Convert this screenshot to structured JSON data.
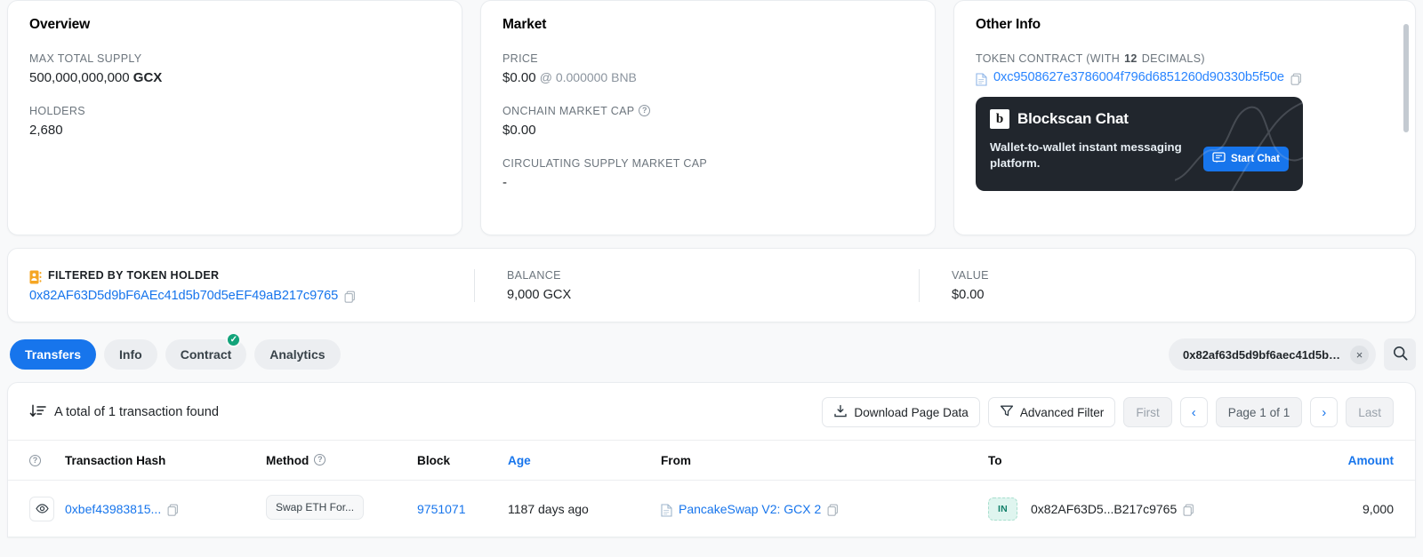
{
  "overview": {
    "title": "Overview",
    "max_total_supply_label": "MAX TOTAL SUPPLY",
    "max_total_supply_value": "500,000,000,000",
    "max_total_supply_symbol": "GCX",
    "holders_label": "HOLDERS",
    "holders_value": "2,680"
  },
  "market": {
    "title": "Market",
    "price_label": "PRICE",
    "price_value": "$0.00",
    "price_secondary": "@ 0.000000 BNB",
    "onchain_market_cap_label": "ONCHAIN MARKET CAP",
    "onchain_market_cap_value": "$0.00",
    "circulating_supply_market_cap_label": "CIRCULATING SUPPLY MARKET CAP",
    "circulating_supply_market_cap_value": "-"
  },
  "other_info": {
    "title": "Other Info",
    "token_contract_label_pre": "TOKEN CONTRACT (WITH ",
    "token_contract_decimals": "12",
    "token_contract_label_post": " DECIMALS)",
    "token_contract_address": "0xc9508627e3786004f796d6851260d90330b5f50e",
    "banner": {
      "logo_letter": "b",
      "title": "Blockscan Chat",
      "description": "Wallet-to-wallet instant messaging platform.",
      "button_label": "Start Chat"
    }
  },
  "filter_strip": {
    "filtered_by_label": "FILTERED BY TOKEN HOLDER",
    "filtered_by_address": "0x82AF63D5d9bF6AEc41d5b70d5eEF49aB217c9765",
    "balance_label": "BALANCE",
    "balance_value": "9,000 GCX",
    "value_label": "VALUE",
    "value_value": "$0.00"
  },
  "tabs": [
    {
      "label": "Transfers",
      "active": true,
      "badge": ""
    },
    {
      "label": "Info",
      "active": false,
      "badge": ""
    },
    {
      "label": "Contract",
      "active": false,
      "badge": "✓"
    },
    {
      "label": "Analytics",
      "active": false,
      "badge": ""
    }
  ],
  "search": {
    "value": "0x82af63d5d9bf6aec41d5b70...",
    "placeholder": "Search",
    "clear_label": "×"
  },
  "table_toolbar": {
    "count_text": "A total of 1 transaction found",
    "download_label": "Download Page Data",
    "advanced_filter_label": "Advanced Filter",
    "first_label": "First",
    "prev_label": "‹",
    "page_label": "Page 1 of 1",
    "next_label": "›",
    "last_label": "Last"
  },
  "table": {
    "columns": [
      {
        "key": "eye",
        "label": "",
        "link": false
      },
      {
        "key": "hash",
        "label": "Transaction Hash",
        "link": false
      },
      {
        "key": "method",
        "label": "Method",
        "link": false
      },
      {
        "key": "block",
        "label": "Block",
        "link": false
      },
      {
        "key": "age",
        "label": "Age",
        "link": true
      },
      {
        "key": "from",
        "label": "From",
        "link": false
      },
      {
        "key": "to",
        "label": "To",
        "link": false
      },
      {
        "key": "amount",
        "label": "Amount",
        "link": true
      }
    ],
    "rows": [
      {
        "hash": "0xbef43983815...",
        "method": "Swap ETH For...",
        "block": "9751071",
        "age": "1187 days ago",
        "from": "PancakeSwap V2: GCX 2",
        "direction": "IN",
        "to": "0x82AF63D5...B217c9765",
        "amount": "9,000"
      }
    ]
  },
  "colors": {
    "accent_blue": "#1775ec",
    "link_blue": "#2a85ff",
    "badge_green": "#12a37a",
    "in_badge_bg": "#dff5ef",
    "in_badge_text": "#12806a",
    "filter_icon_amber": "#f5a623",
    "banner_bg": "#21262d",
    "page_bg": "#f8f9fa"
  }
}
